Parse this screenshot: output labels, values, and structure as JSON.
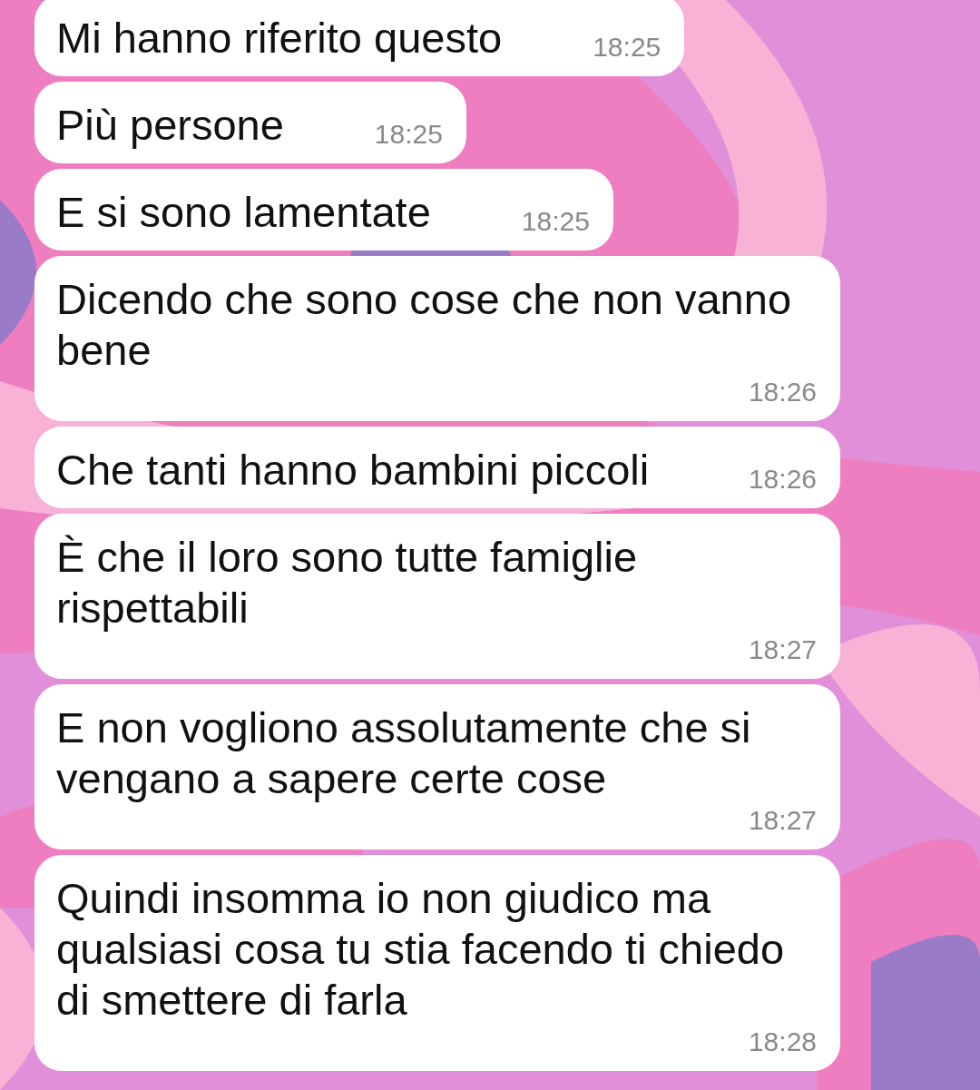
{
  "messages": [
    {
      "text": "Mi hanno riferito questo",
      "time": "18:25"
    },
    {
      "text": "Più persone",
      "time": "18:25"
    },
    {
      "text": "E si sono lamentate",
      "time": "18:25"
    },
    {
      "text": "Dicendo che sono cose che non vanno bene",
      "time": "18:26"
    },
    {
      "text": "Che tanti hanno bambini piccoli",
      "time": "18:26"
    },
    {
      "text": "È che il loro sono tutte famiglie rispettabili",
      "time": "18:27"
    },
    {
      "text": "E non vogliono assolutamente che si vengano a sapere certe cose",
      "time": "18:27"
    },
    {
      "text": "Quindi insomma io non giudico ma qualsiasi cosa tu stia facendo ti chiedo di smettere di farla",
      "time": "18:28"
    }
  ]
}
